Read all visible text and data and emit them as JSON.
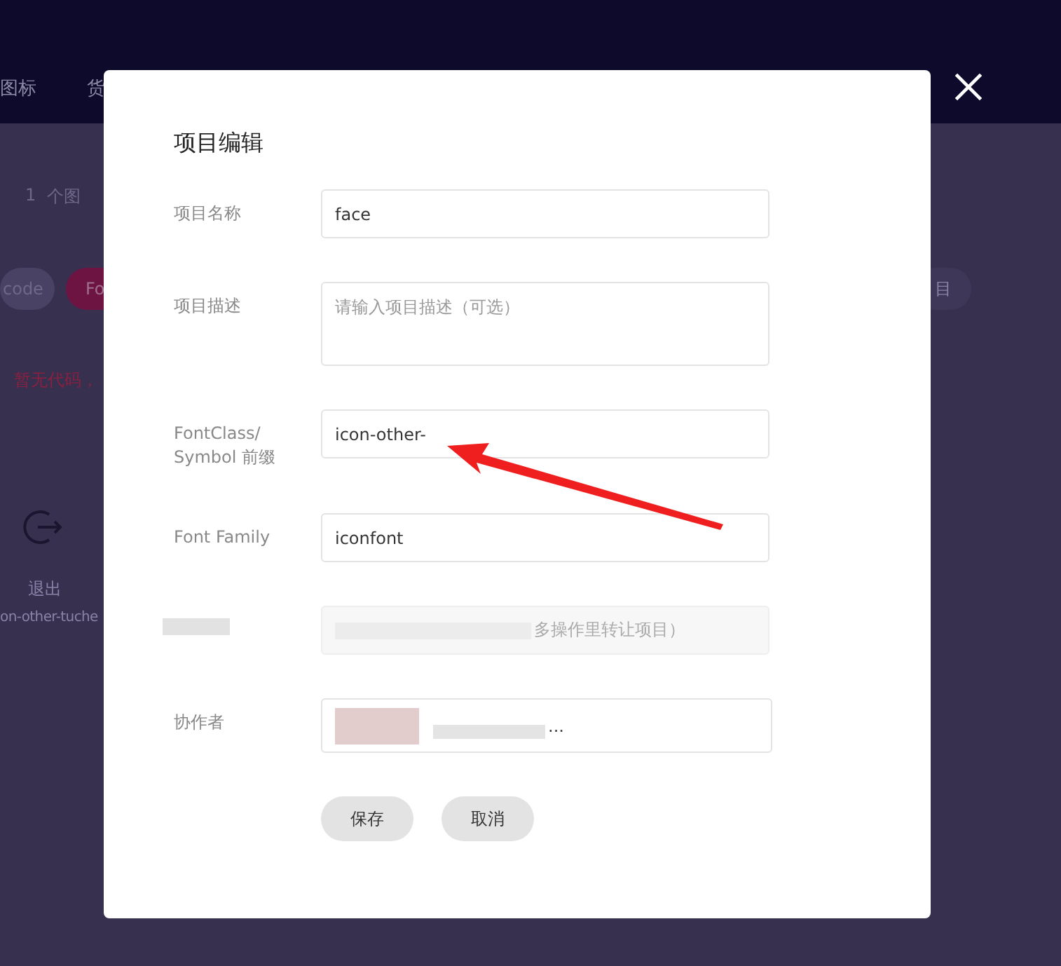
{
  "background": {
    "nav": [
      "图标",
      "货"
    ],
    "count": "1",
    "count_label": "个图",
    "tags": [
      {
        "label": "code",
        "selected": false
      },
      {
        "label": "Fo",
        "selected": true
      }
    ],
    "notice": "暂无代码，",
    "icon_card": {
      "label": "退出",
      "name": "on-other-tuche"
    },
    "right_button": "目"
  },
  "dialog": {
    "title": "项目编辑",
    "fields": [
      {
        "kind": "input",
        "label": "项目名称",
        "value": "face"
      },
      {
        "kind": "textarea",
        "label": "项目描述",
        "placeholder": "请输入项目描述（可选）"
      },
      {
        "kind": "input",
        "label": "FontClass/ Symbol 前缀",
        "value": "icon-other-"
      },
      {
        "kind": "input",
        "label": "Font Family",
        "value": "iconfont"
      },
      {
        "kind": "disabled",
        "placeholder": "多操作里转让项目）"
      },
      {
        "kind": "collaborator",
        "label": "协作者",
        "value": "..."
      }
    ],
    "buttons": [
      "保存",
      "取消"
    ]
  }
}
